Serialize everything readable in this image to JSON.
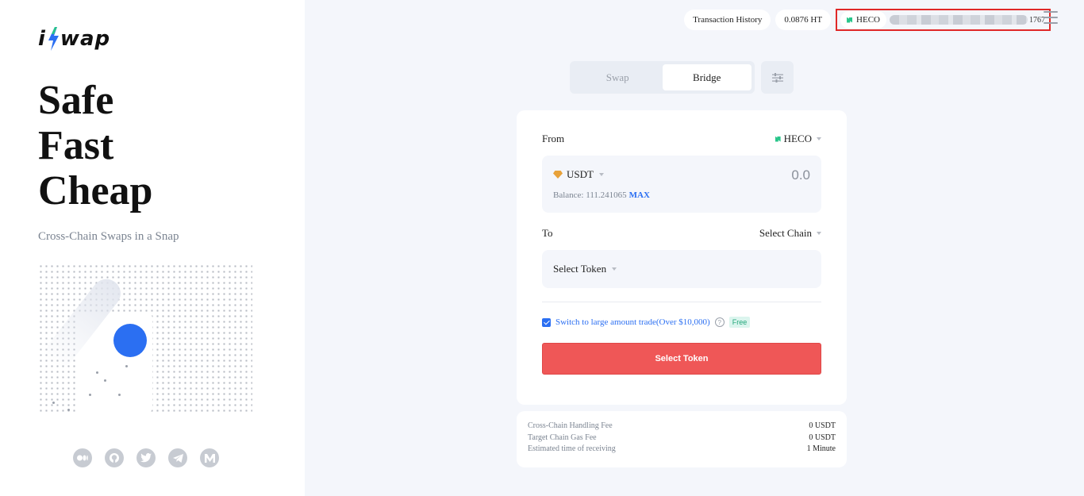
{
  "brand": {
    "logo_text_left": "i",
    "logo_text_right": "wap",
    "hero_lines": [
      "Safe",
      "Fast",
      "Cheap"
    ],
    "tagline": "Cross-Chain Swaps in a Snap",
    "accent_color": "#2b6ff2",
    "socials": [
      "medium-icon",
      "github-icon",
      "twitter-icon",
      "telegram-icon",
      "m-icon"
    ]
  },
  "header": {
    "history_label": "Transaction History",
    "balance_label": "0.0876 HT",
    "network_label": "HECO",
    "address_tail": "1767"
  },
  "tabs": [
    {
      "label": "Swap",
      "active": false
    },
    {
      "label": "Bridge",
      "active": true
    }
  ],
  "from": {
    "label": "From",
    "chain": "HECO",
    "token": "USDT",
    "amount": "0.0",
    "balance_label": "Balance: 111.241065",
    "max_label": "MAX"
  },
  "to": {
    "label": "To",
    "chain": "Select Chain",
    "token": "Select Token"
  },
  "switch": {
    "checked": true,
    "label": "Switch to large amount trade(Over $10,000)",
    "help": "?",
    "badge": "Free"
  },
  "action": {
    "label": "Select Token",
    "color": "#ef5757"
  },
  "fees": [
    {
      "label": "Cross-Chain Handling Fee",
      "value": "0 USDT"
    },
    {
      "label": "Target Chain Gas Fee",
      "value": "0 USDT"
    },
    {
      "label": "Estimated time of receiving",
      "value": "1 Minute"
    }
  ]
}
